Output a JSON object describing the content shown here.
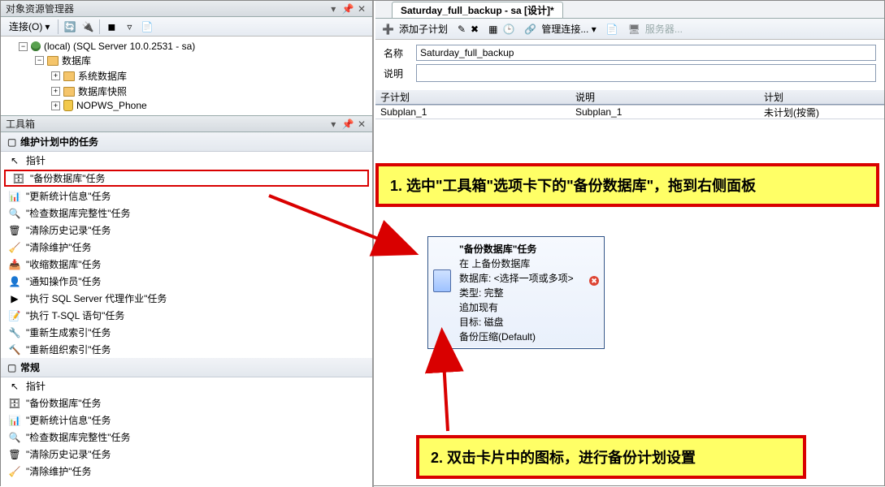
{
  "object_explorer": {
    "title": "对象资源管理器",
    "connect_label": "连接(O)",
    "tree": {
      "root": "(local) (SQL Server 10.0.2531 - sa)",
      "databases": "数据库",
      "sys_db": "系统数据库",
      "db_snapshot": "数据库快照",
      "user_db": "NOPWS_Phone"
    }
  },
  "toolbox": {
    "title": "工具箱",
    "group_tasks": "维护计划中的任务",
    "group_general": "常规",
    "items_tasks": [
      {
        "label": "指针",
        "glyph": "↖"
      },
      {
        "label": "\"备份数据库\"任务",
        "glyph": "🗄"
      },
      {
        "label": "\"更新统计信息\"任务",
        "glyph": "📊"
      },
      {
        "label": "\"检查数据库完整性\"任务",
        "glyph": "🔍"
      },
      {
        "label": "\"清除历史记录\"任务",
        "glyph": "🗑"
      },
      {
        "label": "\"清除维护\"任务",
        "glyph": "🧹"
      },
      {
        "label": "\"收缩数据库\"任务",
        "glyph": "📥"
      },
      {
        "label": "\"通知操作员\"任务",
        "glyph": "👤"
      },
      {
        "label": "\"执行 SQL Server 代理作业\"任务",
        "glyph": "▶"
      },
      {
        "label": "\"执行 T-SQL 语句\"任务",
        "glyph": "📝"
      },
      {
        "label": "\"重新生成索引\"任务",
        "glyph": "🔧"
      },
      {
        "label": "\"重新组织索引\"任务",
        "glyph": "🔨"
      }
    ],
    "items_general": [
      {
        "label": "指针",
        "glyph": "↖"
      },
      {
        "label": "\"备份数据库\"任务",
        "glyph": "🗄"
      },
      {
        "label": "\"更新统计信息\"任务",
        "glyph": "📊"
      },
      {
        "label": "\"检查数据库完整性\"任务",
        "glyph": "🔍"
      },
      {
        "label": "\"清除历史记录\"任务",
        "glyph": "🗑"
      },
      {
        "label": "\"清除维护\"任务",
        "glyph": "🧹"
      }
    ]
  },
  "designer": {
    "tab_title": "Saturday_full_backup - sa [设计]*",
    "toolbar": {
      "add_subplan": "添加子计划",
      "manage_conn": "管理连接...",
      "servers": "服务器..."
    },
    "form": {
      "name_label": "名称",
      "name_value": "Saturday_full_backup",
      "desc_label": "说明",
      "desc_value": ""
    },
    "grid": {
      "col_subplan": "子计划",
      "col_desc": "说明",
      "col_schedule": "计划",
      "row": {
        "subplan": "Subplan_1",
        "desc": "Subplan_1",
        "schedule": "未计划(按需)"
      }
    },
    "task_card": {
      "title": "\"备份数据库\"任务",
      "line1": "在 上备份数据库",
      "line2": "数据库: <选择一项或多项>",
      "line3": "类型: 完整",
      "line4": "追加现有",
      "line5": "目标: 磁盘",
      "line6": "备份压缩(Default)"
    }
  },
  "callouts": {
    "c1": "1.   选中\"工具箱\"选项卡下的\"备份数据库\"，拖到右侧面板",
    "c2": "2.   双击卡片中的图标，进行备份计划设置"
  }
}
